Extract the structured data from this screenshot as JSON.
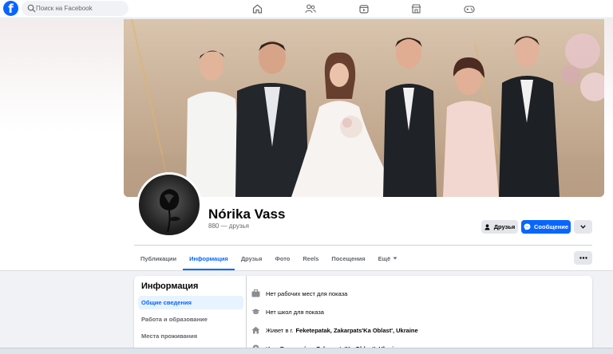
{
  "colors": {
    "brand": "#0866ff",
    "background": "#f0f2f5",
    "secondary_text": "#65676b"
  },
  "topbar": {
    "logo_letter": "f",
    "search_placeholder": "Поиск на Facebook",
    "nav_icons": [
      "home-icon",
      "friends-icon",
      "watch-icon",
      "marketplace-icon",
      "gaming-icon"
    ]
  },
  "profile": {
    "name": "Nórika Vass",
    "friends_count": "880 — друзья"
  },
  "actions": {
    "friends_label": "Друзья",
    "message_label": "Сообщение"
  },
  "tabs": [
    {
      "label": "Публикации",
      "active": false
    },
    {
      "label": "Информация",
      "active": true
    },
    {
      "label": "Друзья",
      "active": false
    },
    {
      "label": "Фото",
      "active": false
    },
    {
      "label": "Reels",
      "active": false
    },
    {
      "label": "Посещения",
      "active": false
    },
    {
      "label": "Ещё",
      "active": false
    }
  ],
  "info": {
    "title": "Информация",
    "sidenav": [
      "Общие сведения",
      "Работа и образование",
      "Места проживания"
    ],
    "rows": {
      "work": "Нет рабочих мест для показа",
      "school": "Нет школ для показа",
      "lives_prefix": "Живет в г.",
      "lives_place": "Feketepatak, Zakarpats'Ka Oblast', Ukraine",
      "from_prefix": "Из г.",
      "from_place": "Beregszász, Zakarpats'Ka Oblast', Ukraine"
    }
  }
}
